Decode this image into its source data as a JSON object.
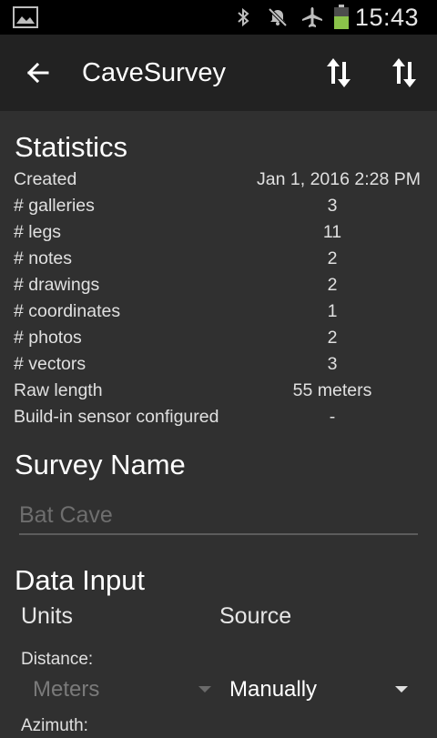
{
  "status_bar": {
    "time": "15:43",
    "icons": [
      "image-notification-icon",
      "bluetooth-icon",
      "mute-icon",
      "airplane-mode-icon",
      "battery-icon"
    ],
    "battery_color": "#8bc34a"
  },
  "app_bar": {
    "title": "CaveSurvey",
    "back_icon": "arrow-back-icon",
    "actions": [
      "sort-icon",
      "sort-icon"
    ]
  },
  "statistics": {
    "title": "Statistics",
    "rows": [
      {
        "label": "Created",
        "value": "Jan 1, 2016 2:28 PM"
      },
      {
        "label": "# galleries",
        "value": "3"
      },
      {
        "label": "# legs",
        "value": "11"
      },
      {
        "label": "# notes",
        "value": "2"
      },
      {
        "label": "# drawings",
        "value": "2"
      },
      {
        "label": "# coordinates",
        "value": "1"
      },
      {
        "label": "# photos",
        "value": "2"
      },
      {
        "label": "# vectors",
        "value": "3"
      },
      {
        "label": "Raw length",
        "value": "55 meters"
      },
      {
        "label": "Build-in sensor configured",
        "value": "-"
      }
    ]
  },
  "survey_name": {
    "title": "Survey Name",
    "placeholder": "Bat Cave",
    "value": ""
  },
  "data_input": {
    "title": "Data Input",
    "units_header": "Units",
    "source_header": "Source",
    "distance_label": "Distance:",
    "distance_unit": "Meters",
    "distance_source": "Manually",
    "azimuth_label": "Azimuth:"
  },
  "colors": {
    "background": "#303030",
    "app_bar": "#222222",
    "status_bar": "#000000",
    "text": "#ffffff",
    "disabled_text": "#7a7a7a"
  }
}
